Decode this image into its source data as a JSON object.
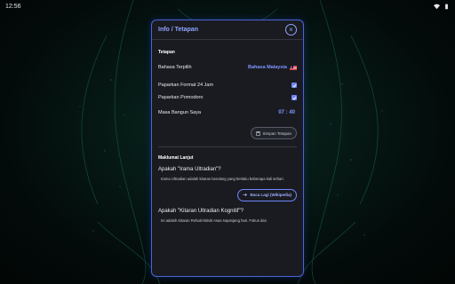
{
  "status_bar": {
    "time": "12:56"
  },
  "dialog": {
    "title": "Info / Tetapan",
    "close_icon": "close-icon"
  },
  "settings": {
    "section_label": "Tetapan",
    "language_label": "Bahasa Terpilih",
    "language_value": "Bahasa Malaysia",
    "format_label": "Paparkan Format 24 Jam",
    "format_checked": true,
    "pomodoro_label": "Paparkan Pomodoro",
    "pomodoro_checked": true,
    "wake_label": "Masa Bangun Saya",
    "wake_value": "07 : 40",
    "save_label": "Simpan Tetapan"
  },
  "more_info": {
    "section_label": "Maklumat Lanjut",
    "q1": "Apakah \"Irama Ultradian\"?",
    "a1": "Irama Ultradian adalah kitaran berulang yang berlaku beberapa kali sehari.",
    "read_more_label": "Baca Lagi (Wikipedia)",
    "q2": "Apakah \"Kitaran Ultradian Kognitif\"?",
    "a2": "Ini adalah Kitaran Rehat/Aktiviti Asas sepanjang hari. Fokus dan"
  },
  "colors": {
    "accent": "#6f86ff",
    "dialog_bg": "#1a1b21",
    "dialog_border": "#4a64d8"
  }
}
